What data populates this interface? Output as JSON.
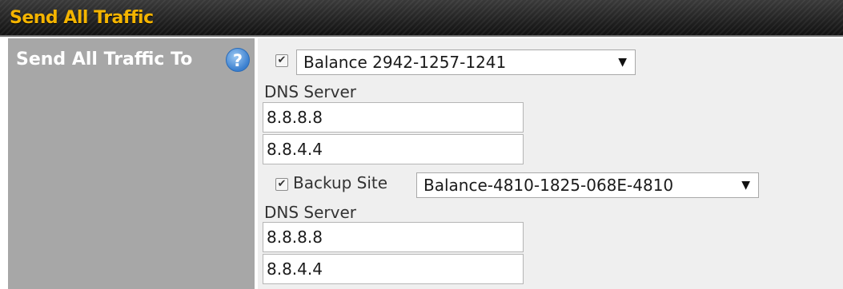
{
  "header": {
    "title": "Send All Traffic"
  },
  "row": {
    "label": "Send All Traffic To",
    "help_glyph": "?"
  },
  "primary": {
    "checked": true,
    "selected_peer": "Balance 2942-1257-1241",
    "dns_label": "DNS Server",
    "dns_1": "8.8.8.8",
    "dns_2": "8.8.4.4"
  },
  "backup": {
    "checked": true,
    "label": "Backup Site",
    "selected_peer": "Balance-4810-1825-068E-4810",
    "dns_label": "DNS Server",
    "dns_1": "8.8.8.8",
    "dns_2": "8.8.4.4"
  },
  "icons": {
    "help": "question-mark-icon",
    "dropdown": "triangle-down-icon",
    "check": "checkmark-icon"
  },
  "colors": {
    "header_title": "#f4b400",
    "label_bg": "#a7a7a7",
    "value_bg": "#efefef",
    "help_icon": "#3a7fcf"
  }
}
